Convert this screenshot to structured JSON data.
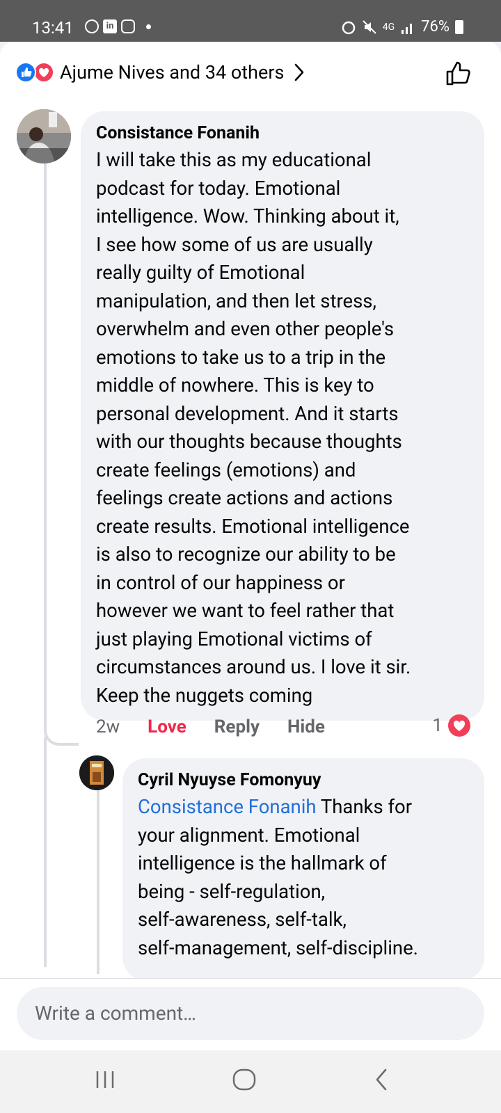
{
  "status_bar": {
    "time": "13:41",
    "battery": "76%",
    "network": "4G"
  },
  "reactions_header": {
    "label": "Ajume Nives and 34 others",
    "reactions": [
      "like",
      "love"
    ]
  },
  "comment": {
    "author": "Consistance Fonanih",
    "text": "I will take this as my educational\npodcast for today. Emotional\nintelligence.  Wow. Thinking about it,\nI see how some of us are usually\nreally guilty of Emotional\nmanipulation, and then let stress,\noverwhelm and even other people's\nemotions to take us to a trip in the\nmiddle of nowhere.  This is key to\npersonal development.  And it starts\nwith our thoughts  because thoughts\ncreate feelings (emotions) and\nfeelings create actions and actions\ncreate results. Emotional intelligence\nis also to recognize our ability to be\nin control of our happiness or\nhowever we want to feel rather that\njust playing Emotional victims of\ncircumstances around us. I love it sir.\nKeep the nuggets coming",
    "time": "2w",
    "love_label": "Love",
    "reply_label": "Reply",
    "hide_label": "Hide",
    "reaction_count": "1"
  },
  "reply": {
    "author": "Cyril Nyuyse Fomonyuy",
    "mention": "Consistance Fonanih",
    "text": " Thanks for\nyour alignment. Emotional\nintelligence is the hallmark of\nbeing - self-regulation,\nself-awareness, self-talk,\nself-management, self-discipline."
  },
  "composer": {
    "placeholder": "Write a comment…"
  },
  "colors": {
    "like_blue": "#1877f2",
    "love_red": "#f33e58",
    "mention_blue": "#216fdb",
    "secondary_text": "#65676b"
  }
}
